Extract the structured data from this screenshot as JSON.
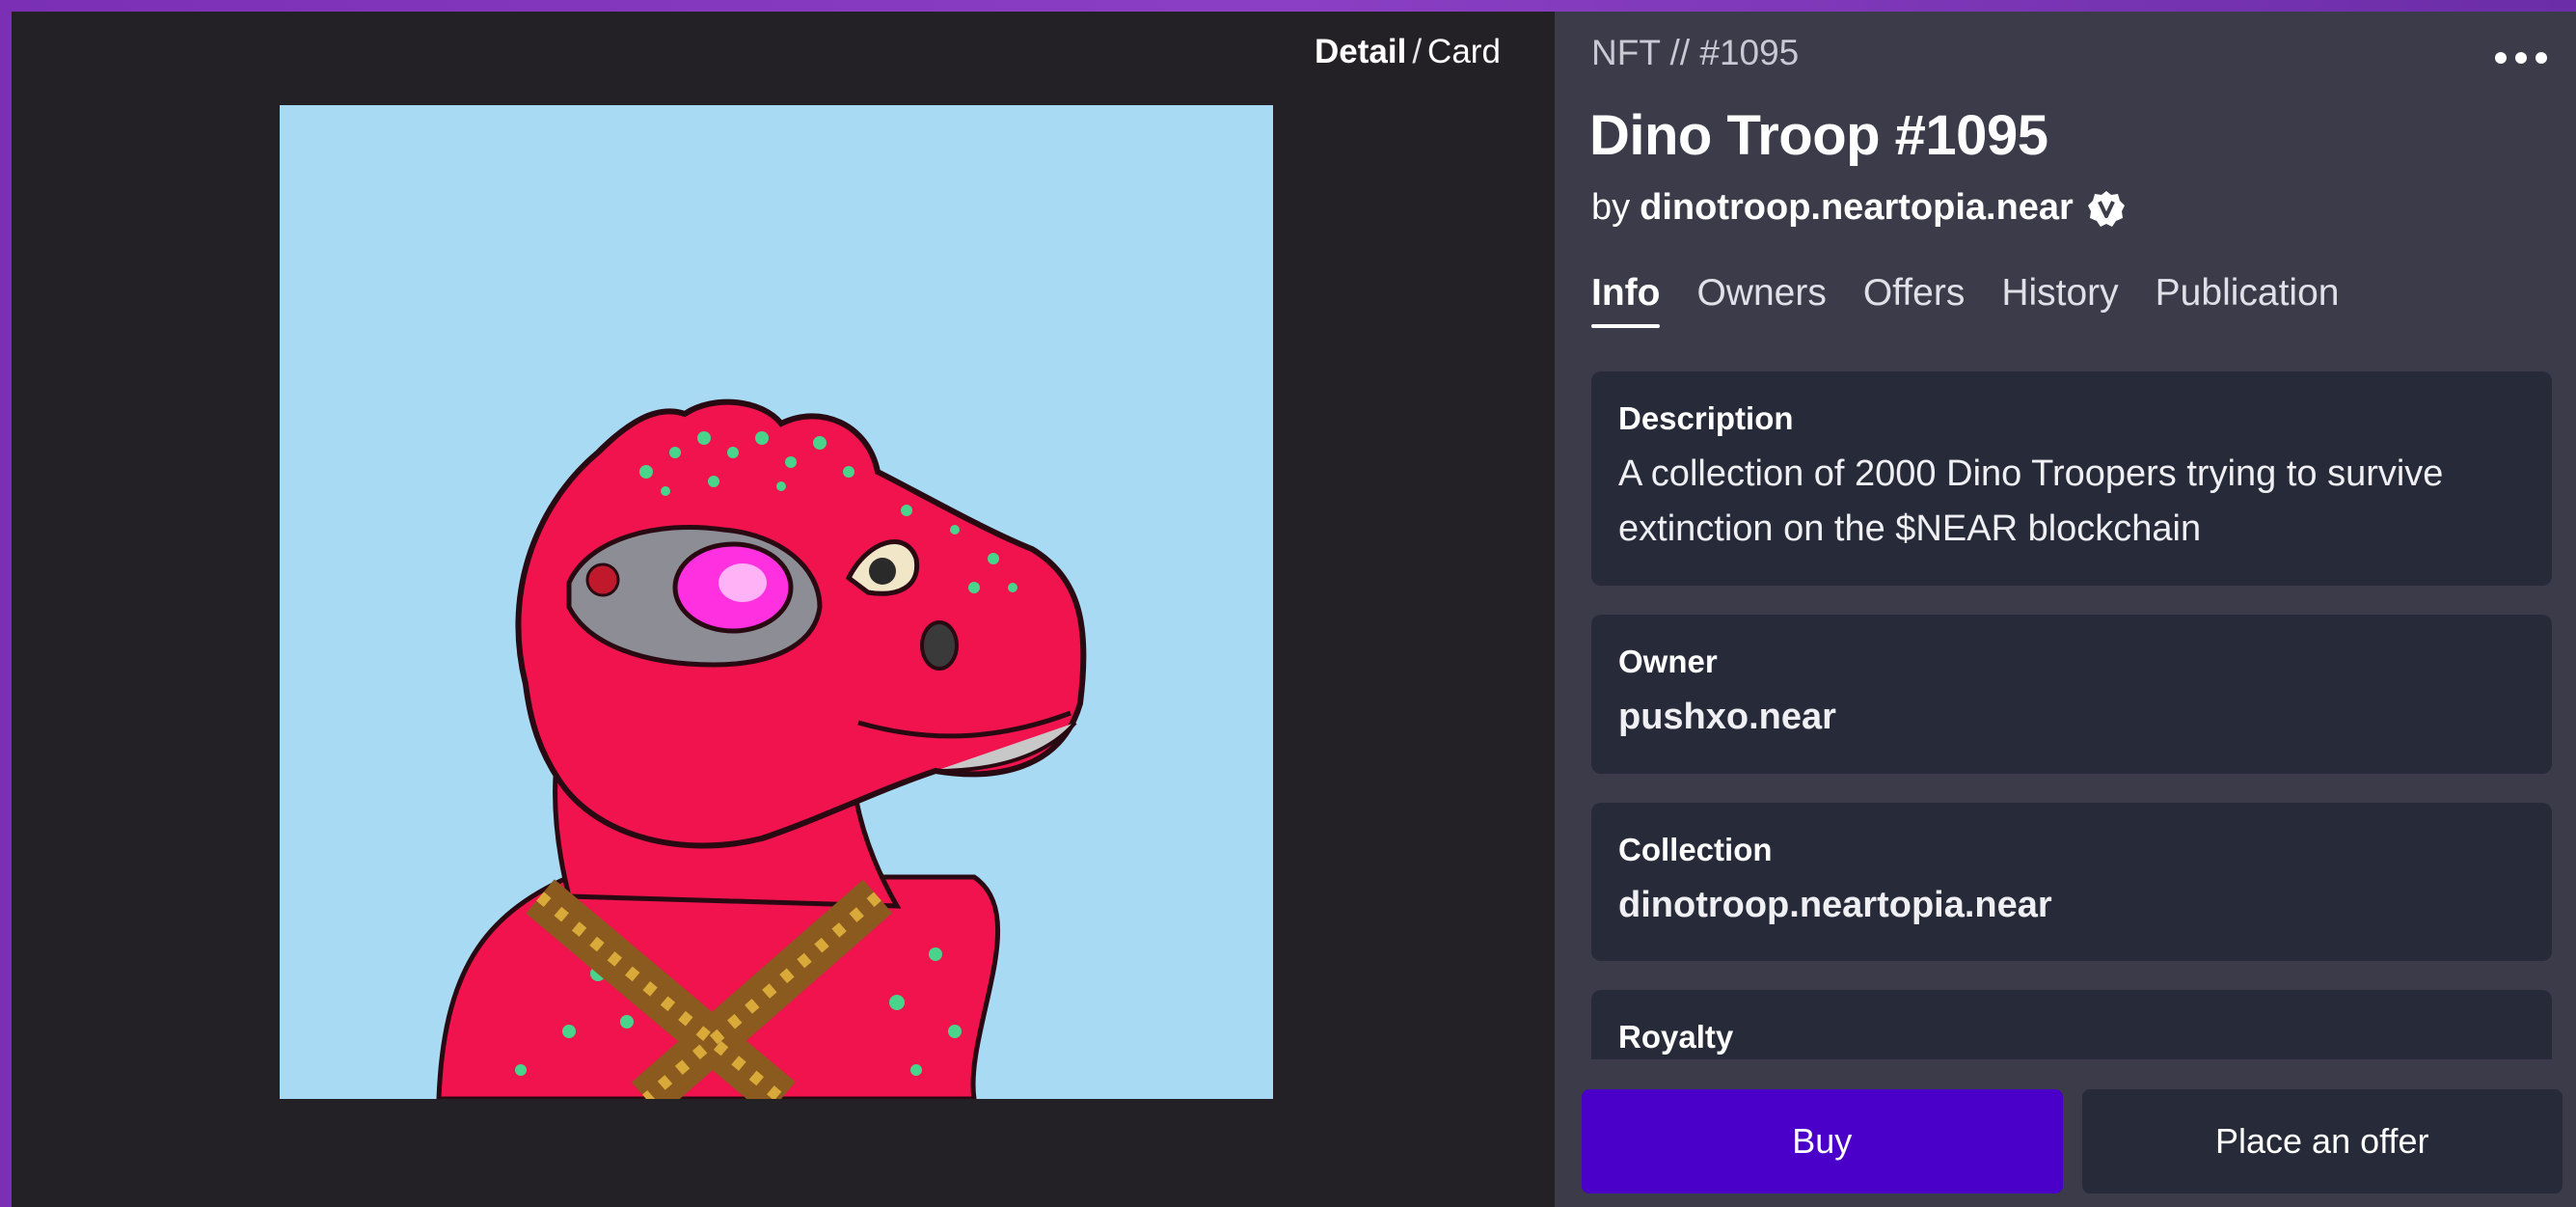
{
  "view_toggle": {
    "detail": "Detail",
    "separator": "/",
    "card": "Card"
  },
  "nft": {
    "id_label": "NFT // #1095",
    "title": "Dino Troop #1095",
    "by_prefix": "by",
    "creator": "dinotroop.neartopia.near"
  },
  "tabs": [
    {
      "label": "Info",
      "active": true
    },
    {
      "label": "Owners"
    },
    {
      "label": "Offers"
    },
    {
      "label": "History"
    },
    {
      "label": "Publication"
    }
  ],
  "info": {
    "description": {
      "label": "Description",
      "value": "A collection of 2000 Dino Troopers trying to survive extinction on the $NEAR blockchain"
    },
    "owner": {
      "label": "Owner",
      "value": "pushxo.near"
    },
    "collection": {
      "label": "Collection",
      "value": "dinotroop.neartopia.near"
    },
    "royalty": {
      "label": "Royalty"
    }
  },
  "actions": {
    "buy": "Buy",
    "offer": "Place an offer"
  },
  "icons": {
    "more": "more-horizontal-icon",
    "verified": "verified-badge-icon"
  },
  "colors": {
    "buy_button": "#4a00c8",
    "panel": "#3b3b4a",
    "card": "#272a38",
    "artwork_bg": "#a9daf4",
    "dino": "#f0134d"
  }
}
